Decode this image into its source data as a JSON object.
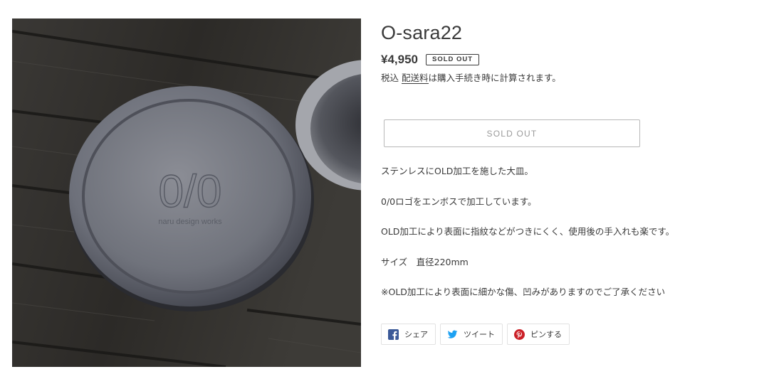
{
  "product": {
    "title": "O-sara22",
    "price": "¥4,950",
    "badge": "SOLD OUT",
    "tax_prefix": "税込",
    "shipping_link": "配送料",
    "tax_suffix": "は購入手続き時に計算されます。",
    "button_label": "SOLD OUT",
    "image_emboss_logo": "0/0",
    "image_emboss_text": "naru design works"
  },
  "description": [
    "ステンレスにOLD加工を施した大皿。",
    "0/0ロゴをエンボスで加工しています。",
    "OLD加工により表面に指紋などがつきにくく、使用後の手入れも楽です。",
    "サイズ　直径220mm",
    "※OLD加工により表面に細かな傷、凹みがありますのでご了承ください"
  ],
  "share": {
    "facebook": "シェア",
    "twitter": "ツイート",
    "pinterest": "ピンする"
  },
  "colors": {
    "facebook": "#3b5998",
    "twitter": "#1da1f2",
    "pinterest": "#cb2027"
  }
}
